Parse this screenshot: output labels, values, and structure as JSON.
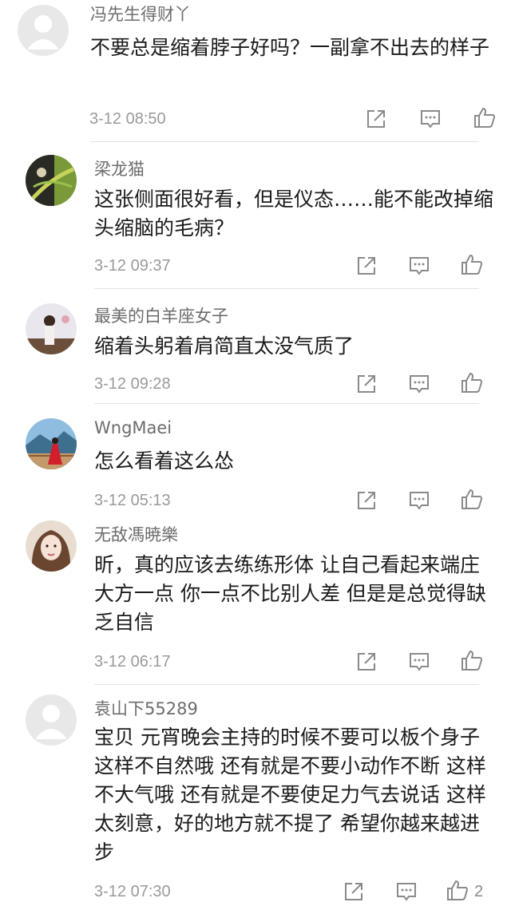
{
  "comments": [
    {
      "username": "冯先生得财丫",
      "text": "不要总是缩着脖子好吗？一副拿不出去的样子",
      "time": "3-12 08:50",
      "avatar": "default-avatar"
    },
    {
      "username": "梁龙猫",
      "text": "这张侧面很好看，但是仪态……能不能改掉缩头缩脑的毛病？",
      "time": "3-12 09:37",
      "avatar": "photo-avatar"
    },
    {
      "username": "最美的白羊座女子",
      "text": "缩着头躬着肩简直太没气质了",
      "time": "3-12 09:28",
      "avatar": "photo-avatar"
    },
    {
      "username": "WngMaei",
      "text": "怎么看着这么怂",
      "time": "3-12 05:13",
      "avatar": "photo-avatar"
    },
    {
      "username": "无敌馮暁樂",
      "text": "昕，真的应该去练练形体 让自己看起来端庄大方一点 你一点不比别人差 但是是总觉得缺乏自信",
      "time": "3-12 06:17",
      "avatar": "photo-avatar"
    },
    {
      "username": "袁山下55289",
      "text": "宝贝 元宵晚会主持的时候不要可以板个身子 这样不自然哦 还有就是不要小动作不断 这样不大气哦 还有就是不要使足力气去说话 这样太刻意，好的地方就不提了 希望你越来越进步",
      "time": "3-12 07:30",
      "avatar": "default-avatar",
      "like_count": "2"
    }
  ],
  "icons": {
    "share": "share-icon",
    "reply": "reply-icon",
    "like": "thumbs-up-icon"
  },
  "colors": {
    "text": "#1b1b1b",
    "meta": "#9a9a9a",
    "username": "#6c6c6c",
    "divider": "#e3e3e3"
  }
}
